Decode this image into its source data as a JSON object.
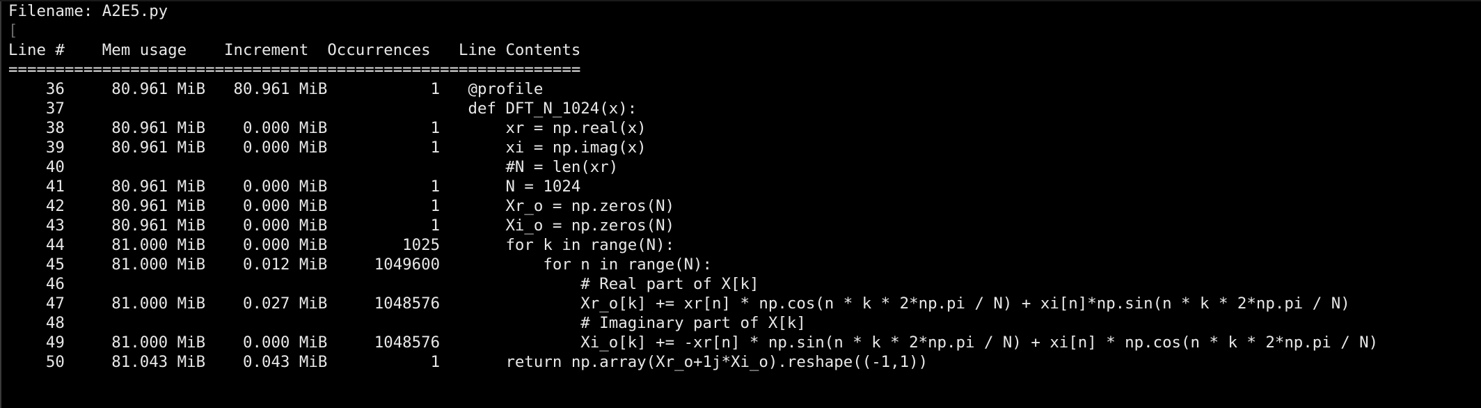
{
  "header": {
    "filename_label": "Filename: A2E5.py",
    "cursor_glyph": "["
  },
  "table": {
    "header_line": "Line #    Mem usage    Increment  Occurrences   Line Contents",
    "separator": "=============================================================",
    "rows": [
      {
        "line": "36",
        "mem": "80.961 MiB",
        "inc": "80.961 MiB",
        "occ": "1",
        "contents": "@profile"
      },
      {
        "line": "37",
        "mem": "",
        "inc": "",
        "occ": "",
        "contents": "def DFT_N_1024(x):"
      },
      {
        "line": "38",
        "mem": "80.961 MiB",
        "inc": "0.000 MiB",
        "occ": "1",
        "contents": "    xr = np.real(x)"
      },
      {
        "line": "39",
        "mem": "80.961 MiB",
        "inc": "0.000 MiB",
        "occ": "1",
        "contents": "    xi = np.imag(x)"
      },
      {
        "line": "40",
        "mem": "",
        "inc": "",
        "occ": "",
        "contents": "    #N = len(xr)"
      },
      {
        "line": "41",
        "mem": "80.961 MiB",
        "inc": "0.000 MiB",
        "occ": "1",
        "contents": "    N = 1024"
      },
      {
        "line": "42",
        "mem": "80.961 MiB",
        "inc": "0.000 MiB",
        "occ": "1",
        "contents": "    Xr_o = np.zeros(N)"
      },
      {
        "line": "43",
        "mem": "80.961 MiB",
        "inc": "0.000 MiB",
        "occ": "1",
        "contents": "    Xi_o = np.zeros(N)"
      },
      {
        "line": "44",
        "mem": "81.000 MiB",
        "inc": "0.000 MiB",
        "occ": "1025",
        "contents": "    for k in range(N):"
      },
      {
        "line": "45",
        "mem": "81.000 MiB",
        "inc": "0.012 MiB",
        "occ": "1049600",
        "contents": "        for n in range(N):"
      },
      {
        "line": "46",
        "mem": "",
        "inc": "",
        "occ": "",
        "contents": "            # Real part of X[k]"
      },
      {
        "line": "47",
        "mem": "81.000 MiB",
        "inc": "0.027 MiB",
        "occ": "1048576",
        "contents": "            Xr_o[k] += xr[n] * np.cos(n * k * 2*np.pi / N) + xi[n]*np.sin(n * k * 2*np.pi / N)"
      },
      {
        "line": "48",
        "mem": "",
        "inc": "",
        "occ": "",
        "contents": "            # Imaginary part of X[k]"
      },
      {
        "line": "49",
        "mem": "81.000 MiB",
        "inc": "0.000 MiB",
        "occ": "1048576",
        "contents": "            Xi_o[k] += -xr[n] * np.sin(n * k * 2*np.pi / N) + xi[n] * np.cos(n * k * 2*np.pi / N)"
      },
      {
        "line": "50",
        "mem": "81.043 MiB",
        "inc": "0.043 MiB",
        "occ": "1",
        "contents": "    return np.array(Xr_o+1j*Xi_o).reshape((-1,1))"
      }
    ]
  }
}
